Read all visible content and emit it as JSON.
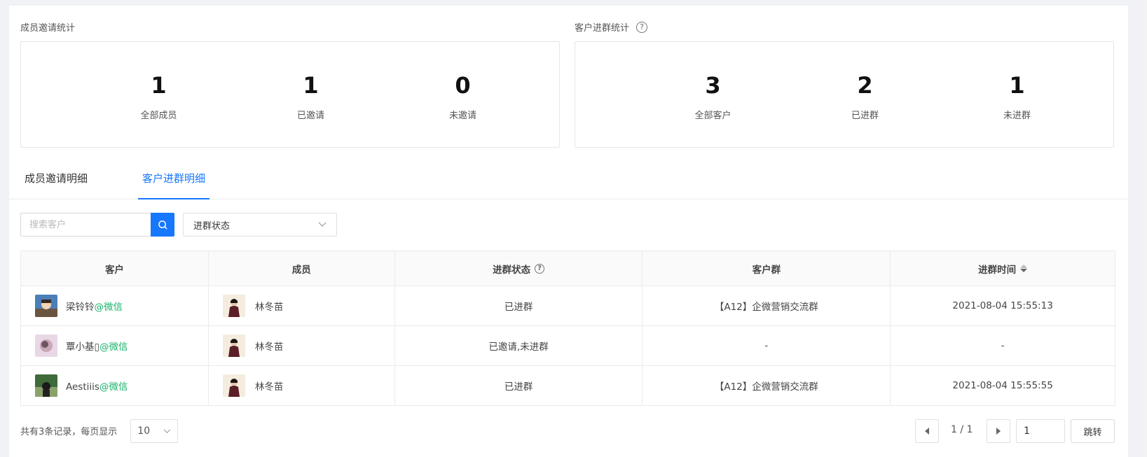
{
  "member_stats": {
    "title": "成员邀请统计",
    "items": [
      {
        "value": "1",
        "label": "全部成员"
      },
      {
        "value": "1",
        "label": "已邀请"
      },
      {
        "value": "0",
        "label": "未邀请"
      }
    ]
  },
  "customer_stats": {
    "title": "客户进群统计",
    "items": [
      {
        "value": "3",
        "label": "全部客户"
      },
      {
        "value": "2",
        "label": "已进群"
      },
      {
        "value": "1",
        "label": "未进群"
      }
    ]
  },
  "tabs": [
    {
      "label": "成员邀请明细"
    },
    {
      "label": "客户进群明细"
    }
  ],
  "filters": {
    "search_placeholder": "搜索客户",
    "status_select": "进群状态"
  },
  "table": {
    "headers": [
      "客户",
      "成员",
      "进群状态",
      "客户群",
      "进群时间"
    ],
    "rows": [
      {
        "customer": "梁铃铃",
        "source": "@微信",
        "member": "林冬苗",
        "status": "已进群",
        "group": "【A12】企微营销交流群",
        "time": "2021-08-04 15:55:13"
      },
      {
        "customer": "覃小基▯",
        "source": "@微信",
        "member": "林冬苗",
        "status": "已邀请,未进群",
        "group": "-",
        "time": "-"
      },
      {
        "customer": "Aestiiis",
        "source": "@微信",
        "member": "林冬苗",
        "status": "已进群",
        "group": "【A12】企微营销交流群",
        "time": "2021-08-04 15:55:55"
      }
    ]
  },
  "pagination": {
    "summary": "共有3条记录，每页显示",
    "page_size": "10",
    "page_info": "1 / 1",
    "page_input": "1",
    "jump_label": "跳转"
  }
}
